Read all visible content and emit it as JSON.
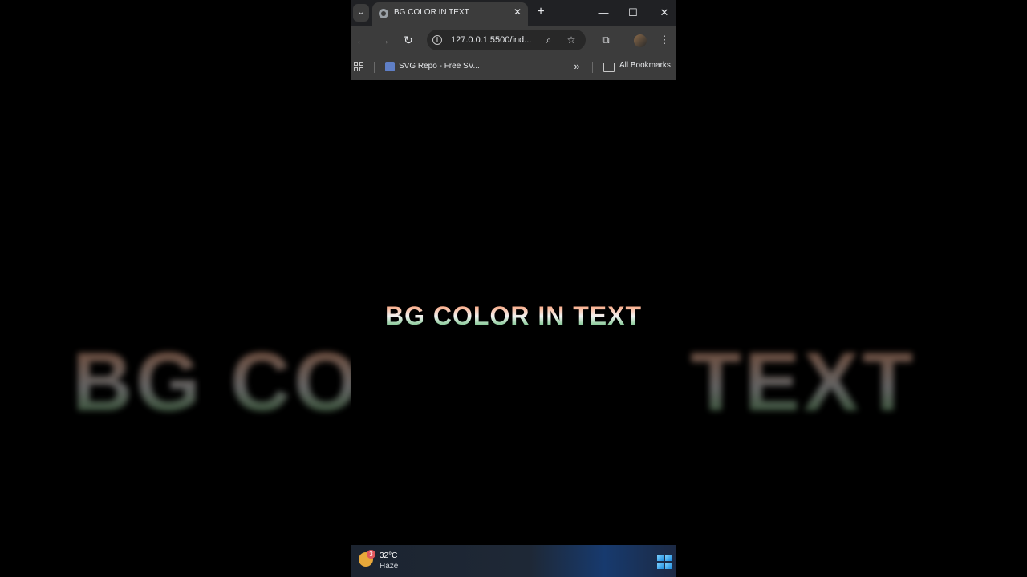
{
  "browser": {
    "tab": {
      "title": "BG COLOR IN TEXT",
      "close": "✕"
    },
    "new_tab": "+",
    "window_controls": {
      "minimize": "—",
      "maximize": "☐",
      "close": "✕"
    },
    "nav": {
      "back": "←",
      "forward": "→",
      "reload": "↻"
    },
    "address_bar": {
      "url": "127.0.0.1:5500/ind..."
    },
    "bookmarks": {
      "items": [
        {
          "label": "SVG Repo - Free SV..."
        }
      ],
      "more": "»",
      "all_bookmarks": "All Bookmarks"
    }
  },
  "page": {
    "heading": "BG COLOR IN TEXT"
  },
  "taskbar": {
    "weather": {
      "temperature": "32°C",
      "condition": "Haze",
      "badge": "3"
    }
  },
  "colors": {
    "gradient_top": "#ff8a55",
    "gradient_middle": "#f2f2f2",
    "gradient_bottom": "#3fae5a"
  }
}
